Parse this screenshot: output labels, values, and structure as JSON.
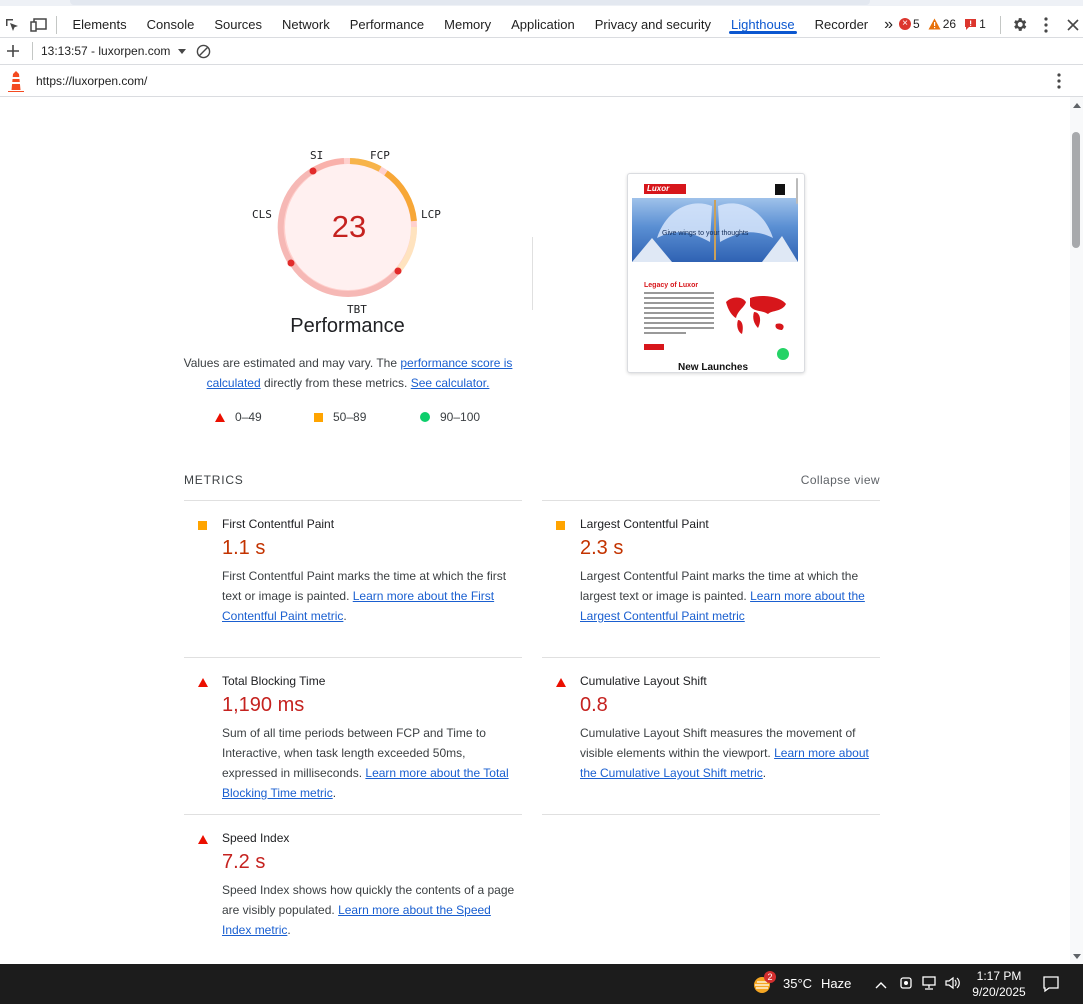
{
  "devtools": {
    "tabs": [
      {
        "label": "Elements"
      },
      {
        "label": "Console"
      },
      {
        "label": "Sources"
      },
      {
        "label": "Network"
      },
      {
        "label": "Performance"
      },
      {
        "label": "Memory"
      },
      {
        "label": "Application"
      },
      {
        "label": "Privacy and security"
      },
      {
        "label": "Lighthouse"
      },
      {
        "label": "Recorder"
      }
    ],
    "more_tabs_glyph": "»",
    "issues": {
      "errors": "5",
      "warnings": "26",
      "messages": "1"
    },
    "report_selector": "13:13:57 - luxorpen.com",
    "url": "https://luxorpen.com/"
  },
  "report": {
    "score": "23",
    "gauge_labels": {
      "si": "SI",
      "fcp": "FCP",
      "lcp": "LCP",
      "tbt": "TBT",
      "cls": "CLS"
    },
    "category_title": "Performance",
    "desc": {
      "pre": "Values are estimated and may vary. The ",
      "link1": "performance score is calculated",
      "mid": " directly from these metrics. ",
      "link2": "See calculator."
    },
    "legend": {
      "fail": "0–49",
      "average": "50–89",
      "pass": "90–100"
    },
    "metrics_title": "METRICS",
    "collapse_label": "Collapse view",
    "metrics": [
      {
        "name": "First Contentful Paint",
        "value": "1.1 s",
        "rating": "average",
        "desc": "First Contentful Paint marks the time at which the first text or image is painted. ",
        "link": "Learn more about the First Contentful Paint metric",
        "after": "."
      },
      {
        "name": "Largest Contentful Paint",
        "value": "2.3 s",
        "rating": "average",
        "desc": "Largest Contentful Paint marks the time at which the largest text or image is painted. ",
        "link": "Learn more about the Largest Contentful Paint metric",
        "after": ""
      },
      {
        "name": "Total Blocking Time",
        "value": "1,190 ms",
        "rating": "fail",
        "desc": "Sum of all time periods between FCP and Time to Interactive, when task length exceeded 50ms, expressed in milliseconds. ",
        "link": "Learn more about the Total Blocking Time metric",
        "after": "."
      },
      {
        "name": "Cumulative Layout Shift",
        "value": "0.8",
        "rating": "fail",
        "desc": "Cumulative Layout Shift measures the movement of visible elements within the viewport. ",
        "link": "Learn more about the Cumulative Layout Shift metric",
        "after": "."
      },
      {
        "name": "Speed Index",
        "value": "7.2 s",
        "rating": "fail",
        "desc": "Speed Index shows how quickly the contents of a page are visibly populated. ",
        "link": "Learn more about the Speed Index metric",
        "after": "."
      }
    ],
    "thumbnail": {
      "logo": "Luxor",
      "hero_text": "Give wings to your thoughts",
      "section_title": "Legacy of Luxor",
      "bottom_text": "New Launches"
    }
  },
  "taskbar": {
    "weather_badge": "2",
    "temperature": "35°C",
    "condition": "Haze",
    "time": "1:17 PM",
    "date": "9/20/2025"
  },
  "colors": {
    "fail": "#eb0f00",
    "average": "#ffa400",
    "pass": "#0cce6b",
    "accent": "#0b57d0"
  }
}
